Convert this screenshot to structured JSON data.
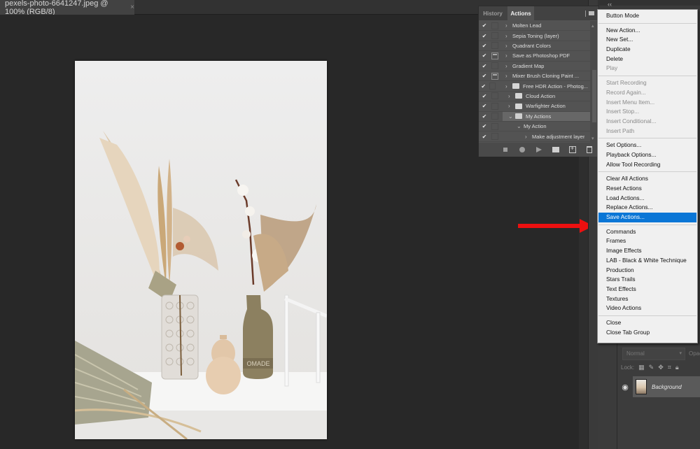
{
  "document_tab": {
    "title": "pexels-photo-6641247.jpeg @ 100% (RGB/8)",
    "close_glyph": "×"
  },
  "actions_panel": {
    "tabs": [
      {
        "label": "History",
        "active": false
      },
      {
        "label": "Actions",
        "active": true
      }
    ],
    "items": [
      {
        "label": "Molten Lead",
        "checked": true,
        "dialog": false,
        "type": "action",
        "expand": "›"
      },
      {
        "label": "Sepia Toning (layer)",
        "checked": true,
        "dialog": false,
        "type": "action",
        "expand": "›"
      },
      {
        "label": "Quadrant Colors",
        "checked": true,
        "dialog": false,
        "type": "action",
        "expand": "›"
      },
      {
        "label": "Save as Photoshop PDF",
        "checked": true,
        "dialog": true,
        "type": "action",
        "expand": "›"
      },
      {
        "label": "Gradient Map",
        "checked": true,
        "dialog": false,
        "type": "action",
        "expand": "›"
      },
      {
        "label": "Mixer Brush Cloning Paint ...",
        "checked": true,
        "dialog": true,
        "type": "action",
        "expand": "›"
      },
      {
        "label": "Free HDR Action - Photog...",
        "checked": true,
        "dialog": false,
        "type": "set",
        "expand": "›"
      },
      {
        "label": "Cloud Action",
        "checked": true,
        "dialog": false,
        "type": "set",
        "expand": "›"
      },
      {
        "label": "Warfighter Action",
        "checked": true,
        "dialog": false,
        "type": "set",
        "expand": "›"
      },
      {
        "label": "My Actions",
        "checked": true,
        "dialog": false,
        "type": "set-open",
        "expand": "⌄",
        "selected": true
      },
      {
        "label": "My Action",
        "checked": true,
        "dialog": false,
        "type": "action-open",
        "expand": "⌄"
      },
      {
        "label": "Make adjustment layer",
        "checked": true,
        "dialog": false,
        "type": "step",
        "expand": "›"
      }
    ],
    "check_glyph": "✔",
    "footer_buttons": [
      "stop-recording",
      "begin-recording",
      "play-selection",
      "create-new-set",
      "create-new-action",
      "delete"
    ]
  },
  "flyout_menu": {
    "groups": [
      [
        {
          "label": "Button Mode",
          "enabled": true
        }
      ],
      [
        {
          "label": "New Action...",
          "enabled": true
        },
        {
          "label": "New Set...",
          "enabled": true
        },
        {
          "label": "Duplicate",
          "enabled": true
        },
        {
          "label": "Delete",
          "enabled": true
        },
        {
          "label": "Play",
          "enabled": false
        }
      ],
      [
        {
          "label": "Start Recording",
          "enabled": false
        },
        {
          "label": "Record Again...",
          "enabled": false
        },
        {
          "label": "Insert Menu Item...",
          "enabled": false
        },
        {
          "label": "Insert Stop...",
          "enabled": false
        },
        {
          "label": "Insert Conditional...",
          "enabled": false
        },
        {
          "label": "Insert Path",
          "enabled": false
        }
      ],
      [
        {
          "label": "Set Options...",
          "enabled": true
        },
        {
          "label": "Playback Options...",
          "enabled": true
        },
        {
          "label": "Allow Tool Recording",
          "enabled": true
        }
      ],
      [
        {
          "label": "Clear All Actions",
          "enabled": true
        },
        {
          "label": "Reset Actions",
          "enabled": true
        },
        {
          "label": "Load Actions...",
          "enabled": true
        },
        {
          "label": "Replace Actions...",
          "enabled": true
        },
        {
          "label": "Save Actions...",
          "enabled": true,
          "highlighted": true
        }
      ],
      [
        {
          "label": "Commands",
          "enabled": true
        },
        {
          "label": "Frames",
          "enabled": true
        },
        {
          "label": "Image Effects",
          "enabled": true
        },
        {
          "label": "LAB - Black & White Technique",
          "enabled": true
        },
        {
          "label": "Production",
          "enabled": true
        },
        {
          "label": "Stars Trails",
          "enabled": true
        },
        {
          "label": "Text Effects",
          "enabled": true
        },
        {
          "label": "Textures",
          "enabled": true
        },
        {
          "label": "Video Actions",
          "enabled": true
        }
      ],
      [
        {
          "label": "Close",
          "enabled": true
        },
        {
          "label": "Close Tab Group",
          "enabled": true
        }
      ]
    ],
    "highlight_color": "#0a76d6"
  },
  "layers_panel": {
    "blend_mode": "Normal",
    "opacity_label": "Opac",
    "lock_label": "Lock:",
    "layers": [
      {
        "name": "Background",
        "visible": true
      }
    ]
  },
  "dock": {
    "collapse_glyph": "‹‹"
  },
  "annotations": {
    "arrow_color": "#ec1010"
  }
}
